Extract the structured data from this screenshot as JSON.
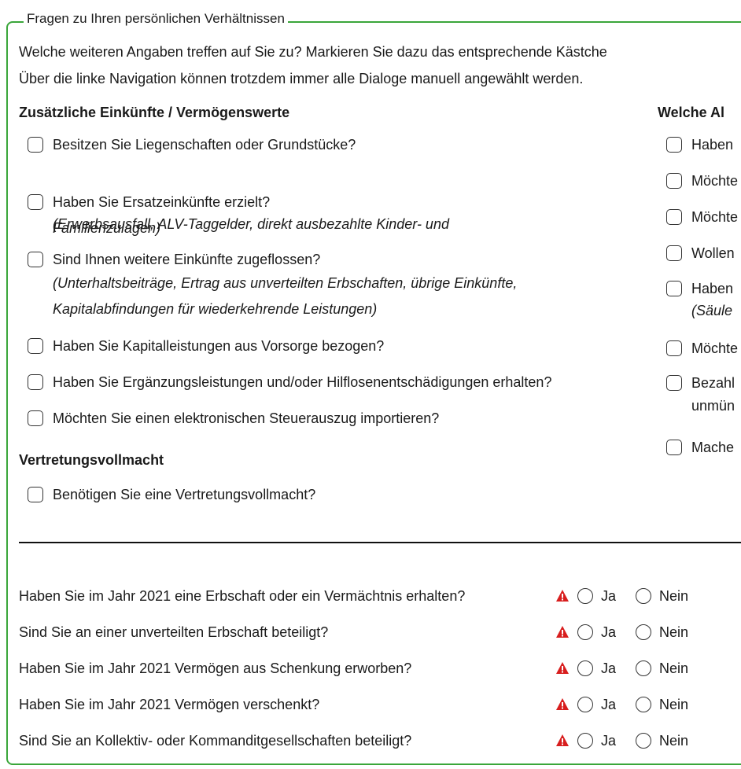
{
  "group": {
    "legend": "Fragen zu Ihren persönlichen Verhältnissen"
  },
  "intro": {
    "line1": "Welche weiteren Angaben treffen auf Sie zu? Markieren Sie dazu das entsprechende Kästche",
    "line2": "Über die linke Navigation können trotzdem immer alle Dialoge manuell angewählt werden."
  },
  "left": {
    "heading": "Zusätzliche Einkünfte / Vermögenswerte",
    "items": [
      {
        "label": "Besitzen Sie Liegenschaften oder Grundstücke?"
      },
      {
        "label": "Haben Sie Ersatzeinkünfte erzielt?",
        "sub1": "(Erwerbsausfall, ALV-Taggelder, direkt ausbezahlte Kinder- und",
        "sub2": "Familienzulagen)"
      },
      {
        "label": "Sind Ihnen weitere Einkünfte zugeflossen?",
        "sub1": "(Unterhaltsbeiträge, Ertrag aus unverteilten Erbschaften, übrige Einkünfte,",
        "sub2": "Kapitalabfindungen für wiederkehrende Leistungen)"
      },
      {
        "label": "Haben Sie Kapitalleistungen aus Vorsorge bezogen?"
      },
      {
        "label": "Haben Sie Ergänzungsleistungen und/oder Hilflosenentschädigungen erhalten?"
      },
      {
        "label": "Möchten Sie einen elektronischen Steuerauszug importieren?"
      }
    ]
  },
  "proxy": {
    "heading": "Vertretungsvollmacht",
    "item": "Benötigen Sie eine Vertretungsvollmacht?"
  },
  "right": {
    "heading": "Welche Al",
    "items": [
      {
        "label": "Haben"
      },
      {
        "label": "Möchte"
      },
      {
        "label": "Möchte"
      },
      {
        "label": "Wollen"
      },
      {
        "label": "Haben",
        "sub1": "(Säule"
      },
      {
        "label": "Möchte"
      },
      {
        "label": "Bezahl",
        "sub1": "unmün"
      },
      {
        "label": "Mache"
      }
    ]
  },
  "questions": {
    "yes": "Ja",
    "no": "Nein",
    "items": [
      {
        "label": "Haben Sie im Jahr 2021 eine Erbschaft oder ein Vermächtnis erhalten?"
      },
      {
        "label": "Sind Sie an einer unverteilten Erbschaft beteiligt?"
      },
      {
        "label": "Haben Sie im Jahr 2021 Vermögen aus Schenkung erworben?"
      },
      {
        "label": "Haben Sie im Jahr 2021 Vermögen verschenkt?"
      },
      {
        "label": "Sind Sie an Kollektiv- oder Kommanditgesellschaften beteiligt?"
      }
    ]
  },
  "colors": {
    "border": "#3aa63a",
    "warning": "#d81e1e"
  },
  "icons": {
    "warning": "warning-triangle-icon"
  }
}
